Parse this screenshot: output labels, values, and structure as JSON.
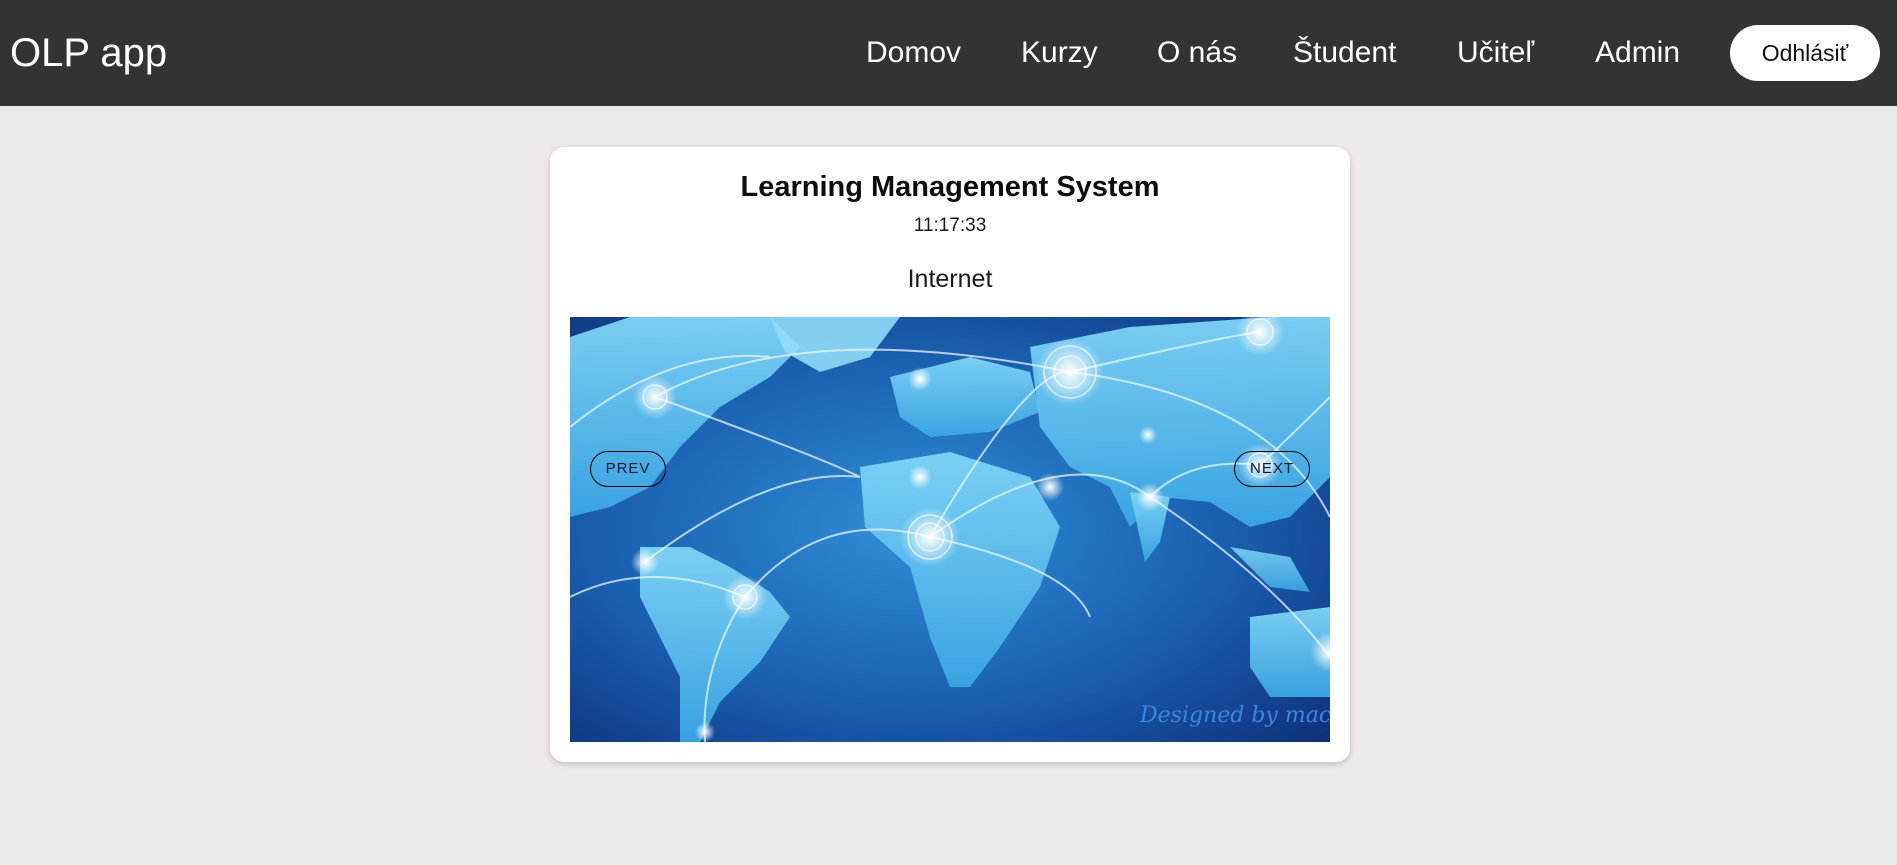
{
  "navbar": {
    "brand": "OLP app",
    "links": [
      {
        "label": "Domov"
      },
      {
        "label": "Kurzy"
      },
      {
        "label": "O nás"
      },
      {
        "label": "Študent"
      },
      {
        "label": "Učiteľ"
      },
      {
        "label": "Admin"
      }
    ],
    "logout_label": "Odhlásiť"
  },
  "card": {
    "title": "Learning Management System",
    "time": "11:17:33",
    "slide_title": "Internet",
    "slide_image": "world-network-map",
    "watermark": "Designed by macrov",
    "prev_label": "PREV",
    "next_label": "NEXT"
  },
  "colors": {
    "navbar_bg": "#333333",
    "page_bg": "#ede9e8",
    "card_bg": "#ffffff",
    "ocean_dark": "#123c8c",
    "land_light": "#5fc0ee"
  }
}
